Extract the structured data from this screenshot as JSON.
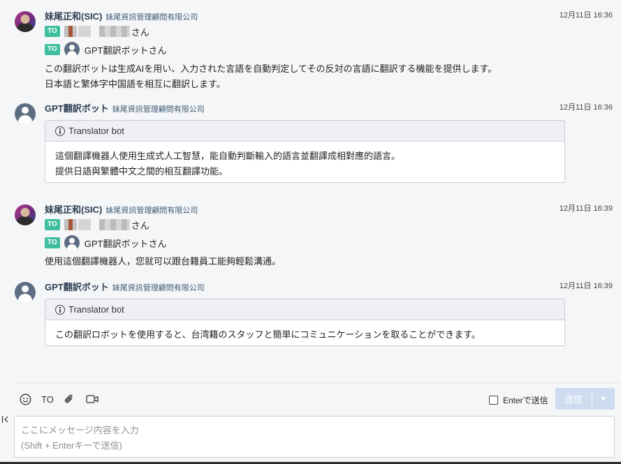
{
  "messages": [
    {
      "sender": "妹尾正和(SIC)",
      "org": "妹尾資訊管理顧問有限公司",
      "time": "12月11日 16:36",
      "avatar": "user-photo",
      "to": [
        {
          "badge": "TO",
          "name": "さん",
          "redacted": true
        },
        {
          "badge": "TO",
          "name": "GPT翻訳ボットさん",
          "redacted": false
        }
      ],
      "lines": [
        "この翻訳ボットは生成AIを用い、入力された言語を自動判定してその反対の言語に翻訳する機能を提供します。",
        "日本語と繁体字中国語を相互に翻訳します。"
      ]
    },
    {
      "sender": "GPT翻訳ボット",
      "org": "妹尾資訊管理顧問有限公司",
      "time": "12月11日 16:36",
      "avatar": "default-user-icon",
      "card_title": "Translator bot",
      "card_lines": [
        "這個翻譯機器人使用生成式人工智慧，能自動判斷輸入的語言並翻譯成相對應的語言。",
        "提供日語與繁體中文之間的相互翻譯功能。"
      ]
    },
    {
      "sender": "妹尾正和(SIC)",
      "org": "妹尾資訊管理顧問有限公司",
      "time": "12月11日 16:39",
      "avatar": "user-photo",
      "to": [
        {
          "badge": "TO",
          "name": "さん",
          "redacted": true
        },
        {
          "badge": "TO",
          "name": "GPT翻訳ボットさん",
          "redacted": false
        }
      ],
      "lines": [
        "使用這個翻譯機器人，您就可以跟台籍員工能夠輕鬆溝通。"
      ]
    },
    {
      "sender": "GPT翻訳ボット",
      "org": "妹尾資訊管理顧問有限公司",
      "time": "12月11日 16:39",
      "avatar": "default-user-icon",
      "card_title": "Translator bot",
      "card_lines": [
        "この翻訳ロボットを使用すると、台湾籍のスタッフと簡単にコミュニケーションを取ることができます。"
      ]
    }
  ],
  "composer": {
    "toolbar": {
      "emoji_icon": "smile-icon",
      "to_label": "TO",
      "attach_icon": "paperclip-icon",
      "video_icon": "video-camera-icon"
    },
    "enter_to_send_label": "Enterで送信",
    "enter_to_send_checked": false,
    "send_label": "送信",
    "send_enabled": false,
    "placeholder": "ここにメッセージ内容を入力\n(Shift + Enterキーで送信)"
  },
  "colors": {
    "to_badge": "#3fbf9f",
    "send_disabled": "#cfdcf0",
    "background": "#f4f6f8"
  }
}
